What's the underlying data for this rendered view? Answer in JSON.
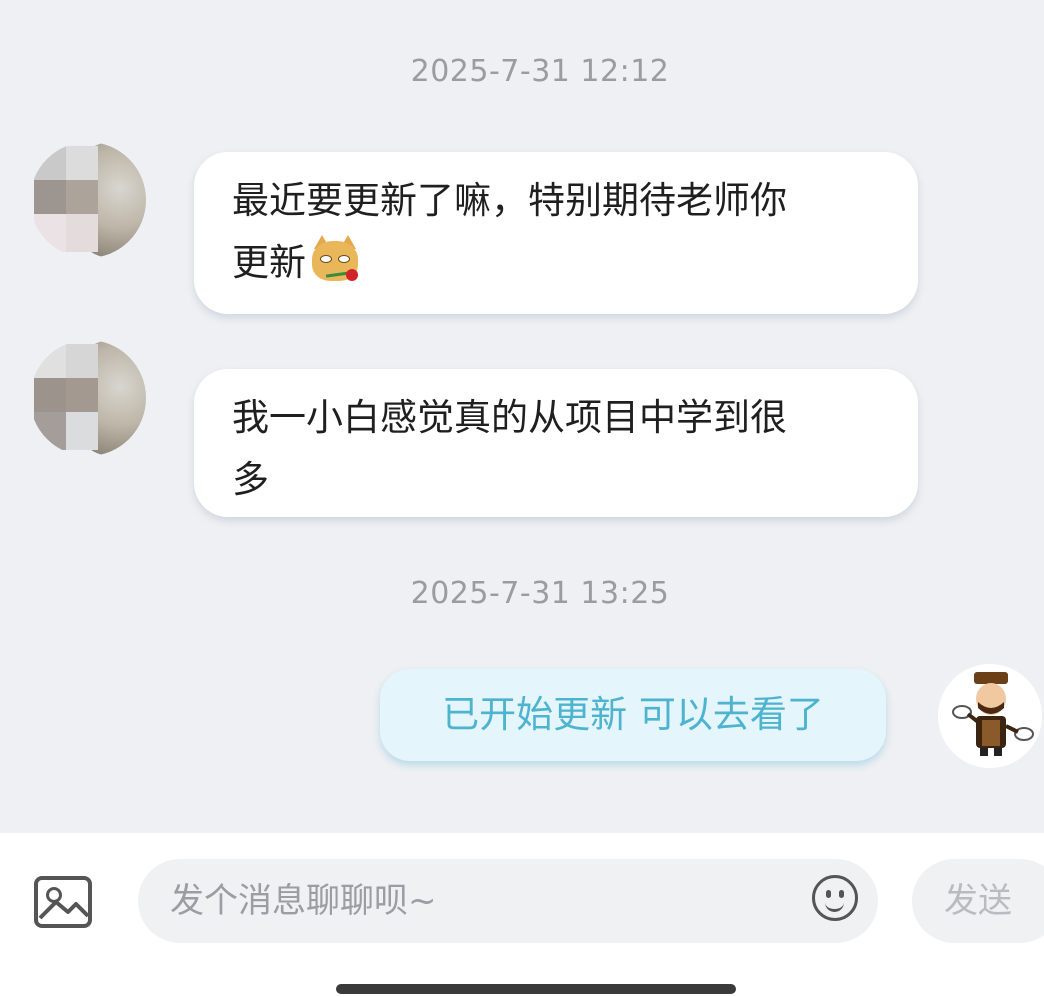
{
  "messages": {
    "timestamp_1": "2025-7-31 12:12",
    "msg_1_line_1": "最近要更新了嘛，特别期待老师你",
    "msg_1_line_2": "更新",
    "msg_1_emoji": "doge-rose-emoji",
    "msg_2_line_1": "我一小白感觉真的从项目中学到很",
    "msg_2_line_2": "多",
    "timestamp_2": "2025-7-31 13:25",
    "reply": "已开始更新 可以去看了"
  },
  "input": {
    "placeholder": "发个消息聊聊呗~",
    "send_label": "发送",
    "image_icon": "image-icon",
    "emoji_icon": "emoji-icon"
  },
  "colors": {
    "background": "#eff0f3",
    "received_bubble": "#ffffff",
    "sent_bubble": "#e4f5fb",
    "sent_text": "#4db3cf",
    "timestamp": "#9a9ca1"
  }
}
